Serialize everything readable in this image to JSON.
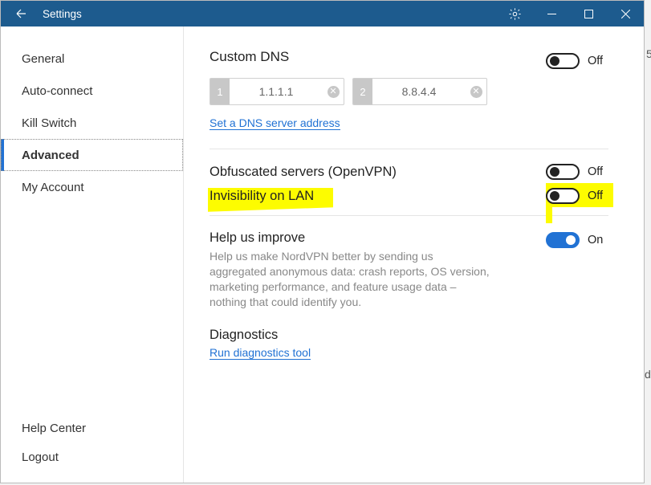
{
  "window": {
    "title": "Settings"
  },
  "nav": {
    "items": [
      {
        "label": "General"
      },
      {
        "label": "Auto-connect"
      },
      {
        "label": "Kill Switch"
      },
      {
        "label": "Advanced"
      },
      {
        "label": "My Account"
      }
    ],
    "active_index": 3,
    "footer": [
      {
        "label": "Help Center"
      },
      {
        "label": "Logout"
      }
    ]
  },
  "dns": {
    "title": "Custom DNS",
    "servers": [
      {
        "num": "1",
        "value": "1.1.1.1"
      },
      {
        "num": "2",
        "value": "8.8.4.4"
      }
    ],
    "link": "Set a DNS server address",
    "toggle": {
      "on": false,
      "state": "Off"
    }
  },
  "obfuscated": {
    "label": "Obfuscated servers (OpenVPN)",
    "toggle": {
      "on": false,
      "state": "Off"
    }
  },
  "lan": {
    "label": "Invisibility on LAN",
    "toggle": {
      "on": false,
      "state": "Off"
    }
  },
  "improve": {
    "label": "Help us improve",
    "desc": "Help us make NordVPN better by sending us aggregated anonymous data: crash reports, OS version, marketing performance, and feature usage data – nothing that could identify you.",
    "toggle": {
      "on": true,
      "state": "On"
    }
  },
  "diagnostics": {
    "title": "Diagnostics",
    "link": "Run diagnostics tool"
  },
  "edge_chars": {
    "a": "5",
    "b": "di"
  }
}
